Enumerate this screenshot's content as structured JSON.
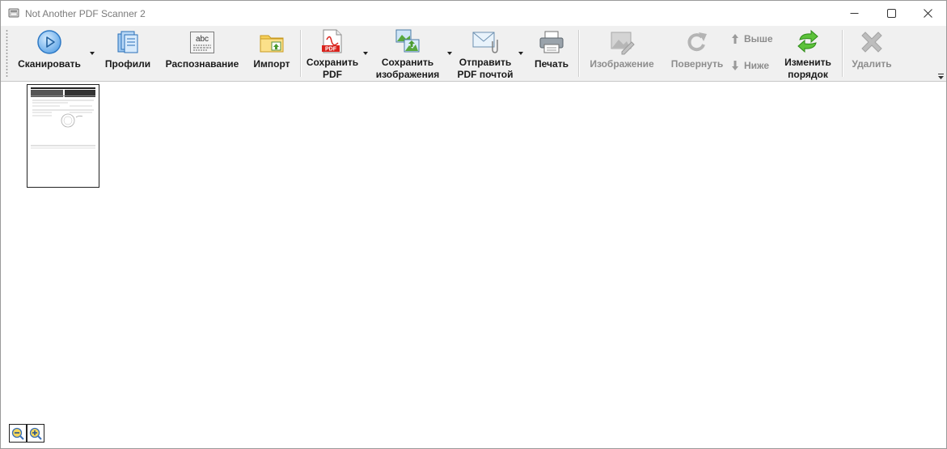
{
  "window": {
    "title": "Not Another PDF Scanner 2",
    "controls": [
      "minimize",
      "maximize",
      "close"
    ]
  },
  "toolbar": {
    "scan": "Сканировать",
    "profiles": "Профили",
    "ocr": "Распознавание",
    "import": "Импорт",
    "save_pdf_1": "Сохранить",
    "save_pdf_2": "PDF",
    "save_images_1": "Сохранить",
    "save_images_2": "изображения",
    "email_pdf_1": "Отправить",
    "email_pdf_2": "PDF почтой",
    "print": "Печать",
    "image": "Изображение",
    "rotate": "Повернуть",
    "move_up": "Выше",
    "move_down": "Ниже",
    "reorder_1": "Изменить",
    "reorder_2": "порядок",
    "delete": "Удалить",
    "pdf_badge": "PDF",
    "ocr_badge": "abc"
  },
  "content": {
    "thumbnails": [
      {
        "page": 1,
        "selected": false
      }
    ],
    "zoom_controls": [
      "zoom-out",
      "zoom-in"
    ]
  },
  "colors": {
    "accent_blue": "#3f8fdf",
    "pdf_red": "#d9231d",
    "disabled_text": "#8d8d8d",
    "reorder_green": "#46b02a"
  }
}
